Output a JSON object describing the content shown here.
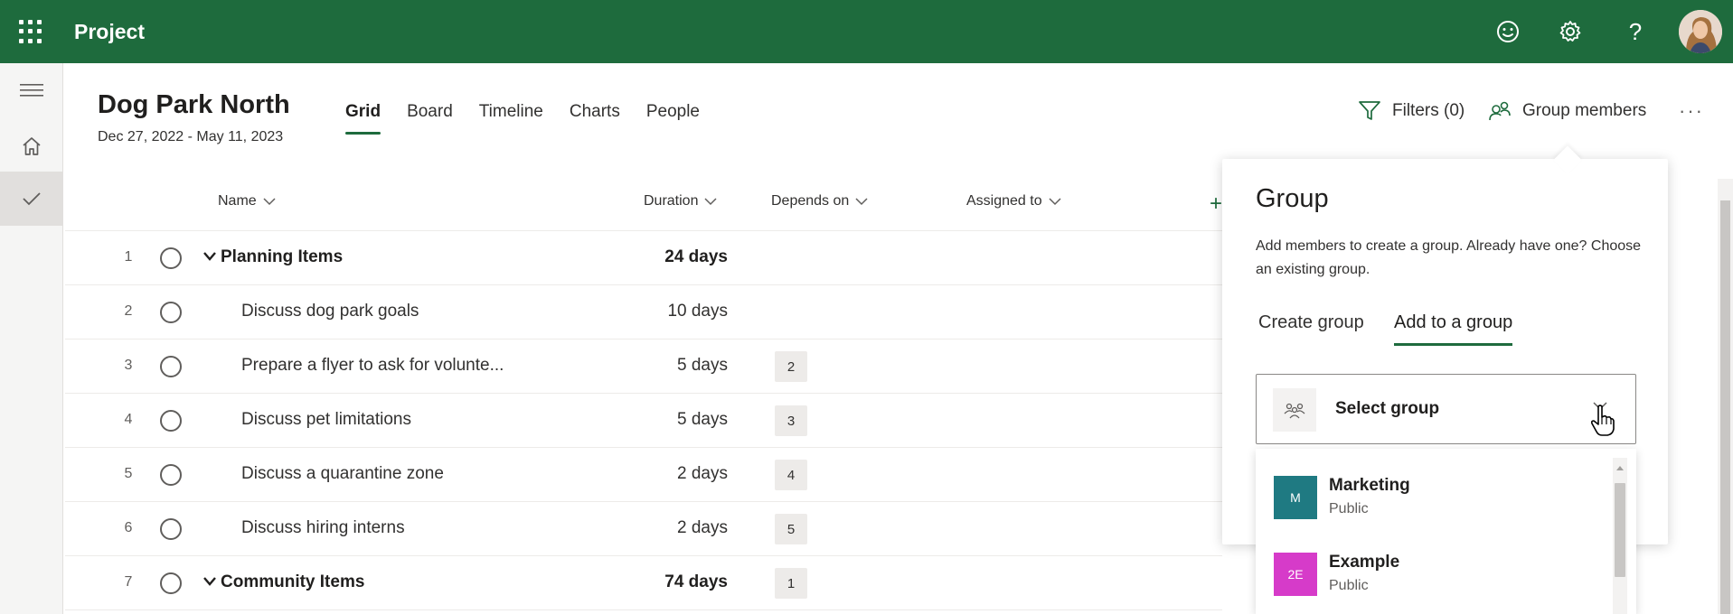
{
  "app": {
    "title": "Project"
  },
  "header": {
    "icons": [
      "waffle-icon",
      "smiley-feedback-icon",
      "gear-icon",
      "help-icon",
      "user-avatar"
    ],
    "help_glyph": "?",
    "colors": {
      "header_bg": "#1e6b3d",
      "accent": "#1e6b3d"
    }
  },
  "project": {
    "title": "Dog Park North",
    "dates": "Dec 27, 2022 - May 11, 2023",
    "tabs": [
      {
        "label": "Grid",
        "active": true
      },
      {
        "label": "Board"
      },
      {
        "label": "Timeline"
      },
      {
        "label": "Charts"
      },
      {
        "label": "People"
      }
    ],
    "filters_label": "Filters (0)",
    "group_members_label": "Group members",
    "more_label": "···"
  },
  "grid": {
    "columns": {
      "name": "Name",
      "duration": "Duration",
      "depends": "Depends on",
      "assigned": "Assigned to"
    },
    "add_column": "+",
    "rows": [
      {
        "num": "1",
        "name": "Planning Items",
        "duration": "24 days",
        "depends": "",
        "group": true
      },
      {
        "num": "2",
        "name": "Discuss dog park goals",
        "duration": "10 days",
        "depends": ""
      },
      {
        "num": "3",
        "name": "Prepare a flyer to ask for volunte...",
        "duration": "5 days",
        "depends": "2"
      },
      {
        "num": "4",
        "name": "Discuss pet limitations",
        "duration": "5 days",
        "depends": "3"
      },
      {
        "num": "5",
        "name": "Discuss a quarantine zone",
        "duration": "2 days",
        "depends": "4"
      },
      {
        "num": "6",
        "name": "Discuss hiring interns",
        "duration": "2 days",
        "depends": "5"
      },
      {
        "num": "7",
        "name": "Community Items",
        "duration": "74 days",
        "depends": "1",
        "group": true
      }
    ]
  },
  "group_panel": {
    "title": "Group",
    "description": "Add members to create a group. Already have one? Choose an existing group.",
    "tabs": [
      {
        "label": "Create group"
      },
      {
        "label": "Add to a group",
        "active": true
      }
    ],
    "select_placeholder": "Select group",
    "options": [
      {
        "initials": "M",
        "name": "Marketing",
        "visibility": "Public",
        "color": "#1f7a82"
      },
      {
        "initials": "2E",
        "name": "Example",
        "visibility": "Public",
        "color": "#d63bc9"
      }
    ]
  }
}
